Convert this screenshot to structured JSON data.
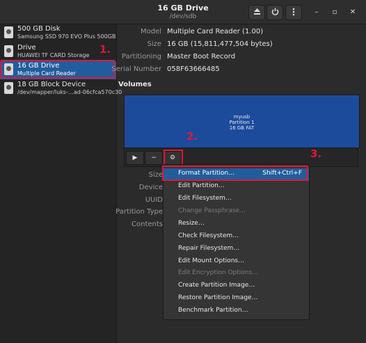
{
  "window": {
    "title": "16 GB Drive",
    "subtitle": "/dev/sdb"
  },
  "header_buttons": [
    {
      "icon": "eject-icon"
    },
    {
      "icon": "power-icon"
    },
    {
      "icon": "kebab-menu-icon"
    }
  ],
  "window_controls": [
    {
      "icon": "minimize-icon",
      "glyph": "–"
    },
    {
      "icon": "maximize-icon",
      "glyph": "▫"
    },
    {
      "icon": "close-icon",
      "glyph": "✕"
    }
  ],
  "sidebar": {
    "items": [
      {
        "name": "500 GB Disk",
        "description": "Samsung SSD 970 EVO Plus 500GB",
        "selected": false
      },
      {
        "name": "Drive",
        "description": "HUAWEI TF CARD Storage",
        "selected": false
      },
      {
        "name": "16 GB Drive",
        "description": "Multiple Card  Reader",
        "selected": true
      },
      {
        "name": "18 GB Block Device",
        "description": "/dev/mapper/luks-…ad-06cfca570c30",
        "selected": false
      }
    ]
  },
  "drive_details": {
    "model_label": "Model",
    "model": "Multiple Card  Reader (1.00)",
    "size_label": "Size",
    "size": "16 GB (15,811,477,504 bytes)",
    "partitioning_label": "Partitioning",
    "partitioning": "Master Boot Record",
    "serial_label": "Serial Number",
    "serial": "058F63666485"
  },
  "volumes": {
    "title": "Volumes",
    "partition": {
      "name": "myusb",
      "number": "Partition 1",
      "desc": "16 GB FAT"
    }
  },
  "volume_details_labels": {
    "size": "Size",
    "device": "Device",
    "uuid": "UUID",
    "partition_type": "Partition Type",
    "contents": "Contents"
  },
  "toolbar": [
    {
      "icon": "play-icon",
      "glyph": "▶"
    },
    {
      "icon": "minus-icon",
      "glyph": "−"
    },
    {
      "icon": "gears-icon",
      "glyph": "⚙"
    }
  ],
  "partition_menu": [
    {
      "label": "Format Partition…",
      "accel": "Shift+Ctrl+F",
      "enabled": true,
      "highlighted": true
    },
    {
      "label": "Edit Partition…",
      "enabled": true
    },
    {
      "label": "Edit Filesystem…",
      "enabled": true
    },
    {
      "label": "Change Passphrase…",
      "enabled": false
    },
    {
      "label": "Resize…",
      "enabled": true
    },
    {
      "label": "Check Filesystem…",
      "enabled": true
    },
    {
      "label": "Repair Filesystem…",
      "enabled": true
    },
    {
      "label": "Edit Mount Options…",
      "enabled": true
    },
    {
      "label": "Edit Encryption Options…",
      "enabled": false
    },
    {
      "label": "Create Partition Image…",
      "enabled": true
    },
    {
      "label": "Restore Partition Image…",
      "enabled": true
    },
    {
      "label": "Benchmark Partition…",
      "enabled": true
    }
  ],
  "annotations": {
    "step1": "1.",
    "step2": "2.",
    "step3": "3.",
    "color": "#e0163a"
  },
  "colors": {
    "accent": "#215d9c",
    "partition_fill": "#1c4b9c",
    "background": "#2b2b2b"
  }
}
